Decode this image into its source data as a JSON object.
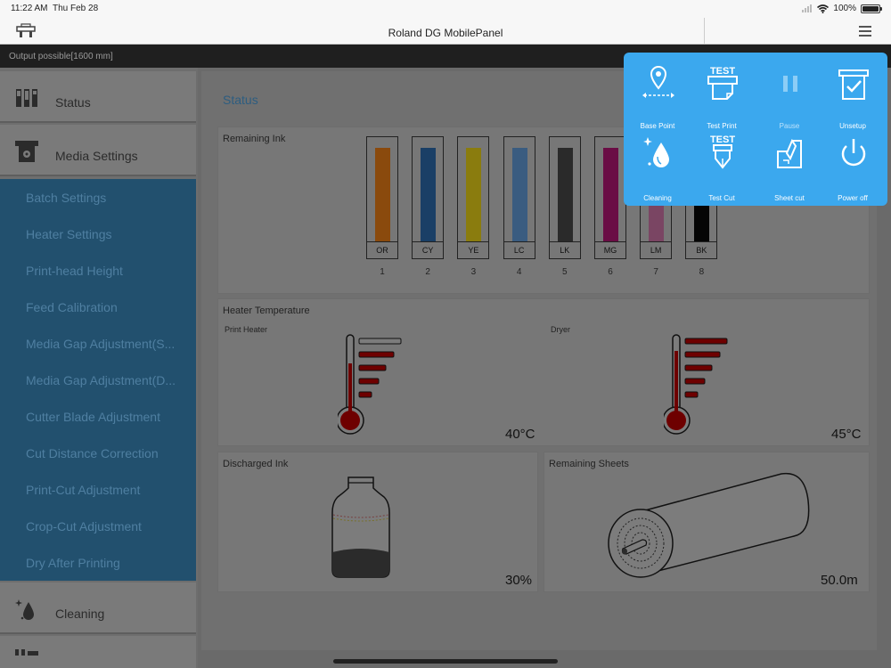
{
  "statusbar": {
    "time": "11:22 AM",
    "date": "Thu Feb 28",
    "battery": "100%"
  },
  "navbar": {
    "title": "Roland DG MobilePanel"
  },
  "output_status": "Output possible[1600 mm]",
  "sidebar": {
    "main_items": [
      {
        "label": "Status",
        "icon": "status-icon"
      },
      {
        "label": "Media Settings",
        "icon": "media-settings-icon"
      },
      {
        "label": "Cleaning",
        "icon": "cleaning-icon"
      }
    ],
    "submenu": [
      "Batch Settings",
      "Heater Settings",
      "Print-head Height",
      "Feed Calibration",
      "Media Gap Adjustment(S...",
      "Media Gap Adjustment(D...",
      "Cutter Blade Adjustment",
      "Cut Distance Correction",
      "Print-Cut Adjustment",
      "Crop-Cut Adjustment",
      "Dry After Printing"
    ]
  },
  "main": {
    "page_title": "Status",
    "remaining_ink": {
      "title": "Remaining Ink",
      "inks": [
        {
          "code": "OR",
          "num": "1",
          "color": "#8a4a0d"
        },
        {
          "code": "CY",
          "num": "2",
          "color": "#1a3f66"
        },
        {
          "code": "YE",
          "num": "3",
          "color": "#8a7c0e"
        },
        {
          "code": "LC",
          "num": "4",
          "color": "#3a5c80"
        },
        {
          "code": "LK",
          "num": "5",
          "color": "#2a2a2a"
        },
        {
          "code": "MG",
          "num": "6",
          "color": "#6a0d45"
        },
        {
          "code": "LM",
          "num": "7",
          "color": "#7a4563"
        },
        {
          "code": "BK",
          "num": "8",
          "color": "#050505"
        }
      ]
    },
    "heater": {
      "title": "Heater Temperature",
      "print_heater": {
        "label": "Print Heater",
        "value": "40°C",
        "level": 4
      },
      "dryer": {
        "label": "Dryer",
        "value": "45°C",
        "level": 5
      }
    },
    "discharged_ink": {
      "title": "Discharged Ink",
      "value": "30%",
      "fill_fraction": 0.3
    },
    "remaining_sheets": {
      "title": "Remaining Sheets",
      "value": "50.0m"
    }
  },
  "popup": {
    "items": [
      {
        "label": "Base Point",
        "icon": "base-point-icon",
        "enabled": true
      },
      {
        "label": "Test Print",
        "icon": "test-print-icon",
        "enabled": true
      },
      {
        "label": "Pause",
        "icon": "pause-icon",
        "enabled": false
      },
      {
        "label": "Unsetup",
        "icon": "unsetup-icon",
        "enabled": true
      },
      {
        "label": "Cleaning",
        "icon": "cleaning-drop-icon",
        "enabled": true
      },
      {
        "label": "Test Cut",
        "icon": "test-cut-icon",
        "enabled": true
      },
      {
        "label": "Sheet cut",
        "icon": "sheet-cut-icon",
        "enabled": true
      },
      {
        "label": "Power off",
        "icon": "power-icon",
        "enabled": true
      }
    ],
    "icon_text": "TEST"
  },
  "colors": {
    "accent": "#3ba8ee",
    "submenu_bg": "#22506e",
    "heater_red": "#6e0000"
  }
}
